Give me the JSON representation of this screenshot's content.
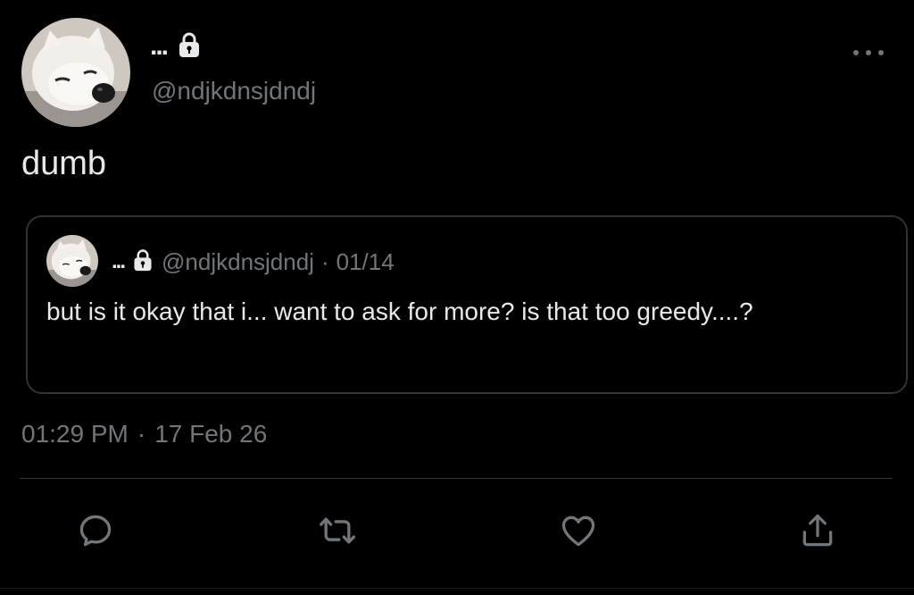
{
  "author": {
    "display_name": "...",
    "handle": "@ndjkdnsjdndj",
    "avatar_icon": "white-dog-avatar",
    "protected_icon": "lock-icon"
  },
  "tweet": {
    "text": "dumb",
    "time": "01:29 PM",
    "separator": "·",
    "date": "17 Feb 26"
  },
  "quoted": {
    "display_name": "...",
    "handle": "@ndjkdnsjdndj",
    "separator": "·",
    "date": "01/14",
    "text": "but is it okay that i... want to ask for more? is that too greedy....?"
  },
  "actions": {
    "reply_icon": "reply-icon",
    "retweet_icon": "retweet-icon",
    "like_icon": "heart-icon",
    "share_icon": "share-icon",
    "more_icon": "more-options-icon"
  },
  "colors": {
    "background": "#000000",
    "text_primary": "#e7e9ea",
    "text_secondary": "#71767b",
    "border": "#2f3336"
  }
}
